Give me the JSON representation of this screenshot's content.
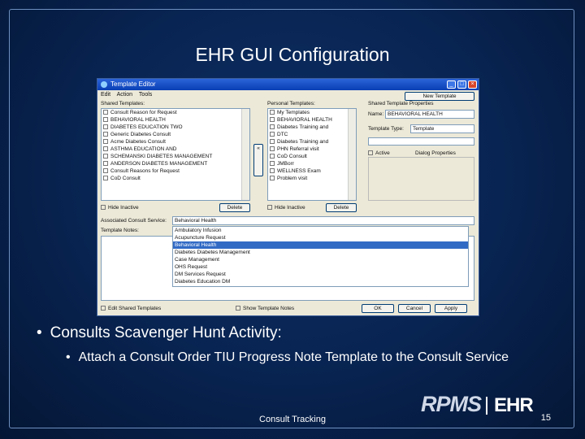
{
  "slide": {
    "title": "EHR GUI Configuration",
    "bullet1": "Consults Scavenger Hunt Activity:",
    "bullet2": "Attach a Consult Order TIU Progress Note Template to the Consult Service",
    "footer": "Consult Tracking",
    "page_number": "15",
    "logo_text": "RPMS",
    "logo_ehr": "EHR"
  },
  "window": {
    "title": "Template Editor",
    "menu": [
      "Edit",
      "Action",
      "Tools"
    ],
    "new_template_button": "New Template",
    "shared_templates_label": "Shared Templates:",
    "personal_templates_label": "Personal Templates:",
    "shared_properties_label": "Shared Template Properties",
    "name_label": "Name:",
    "name_value": "BEHAVIORAL HEALTH",
    "template_type_label": "Template Type:",
    "template_type_value": "Template",
    "active_label": "Active",
    "dialog_props_label": "Dialog Properties",
    "hide_inactive": "Hide Inactive",
    "delete_button": "Delete",
    "assoc_service_label": "Associated Consult Service:",
    "assoc_service_value": "Behavioral Health",
    "template_notes_label": "Template Notes:",
    "edit_shared_label": "Edit Shared Templates",
    "show_notes_label": "Show Template Notes",
    "ok_button": "OK",
    "cancel_button": "Cancel",
    "apply_button": "Apply"
  },
  "shared_tree": [
    "Consult Reason for Request",
    "BEHAVIORAL HEALTH",
    "DIABETES EDUCATION TWO",
    "Generic Diabetes Consult",
    "Acme Diabetes Consult",
    "ASTHMA EDUCATION AND",
    "SCHEMANSKI DIABETES MANAGEMENT",
    "ANDERSON DIABETES MANAGEMENT",
    "Consult Reasons for Request",
    "CoD Consult"
  ],
  "personal_tree": [
    "My Templates",
    "BEHAVIORAL HEALTH",
    "Diabetes Training and",
    "DTC",
    "Diabetes Training and",
    "PHN Referral visit",
    "CoD Consult",
    "JMBorr",
    "WELLNESS Exam",
    "Problem visit"
  ],
  "service_list": [
    "Ambulatory Infusion",
    "Acupuncture Request",
    "Behavioral Health",
    "Diabetes Diabetes Management",
    "Case Management",
    "OHS Request",
    "DM Services Request",
    "Diabetes Education DM"
  ],
  "service_selected_index": 2
}
